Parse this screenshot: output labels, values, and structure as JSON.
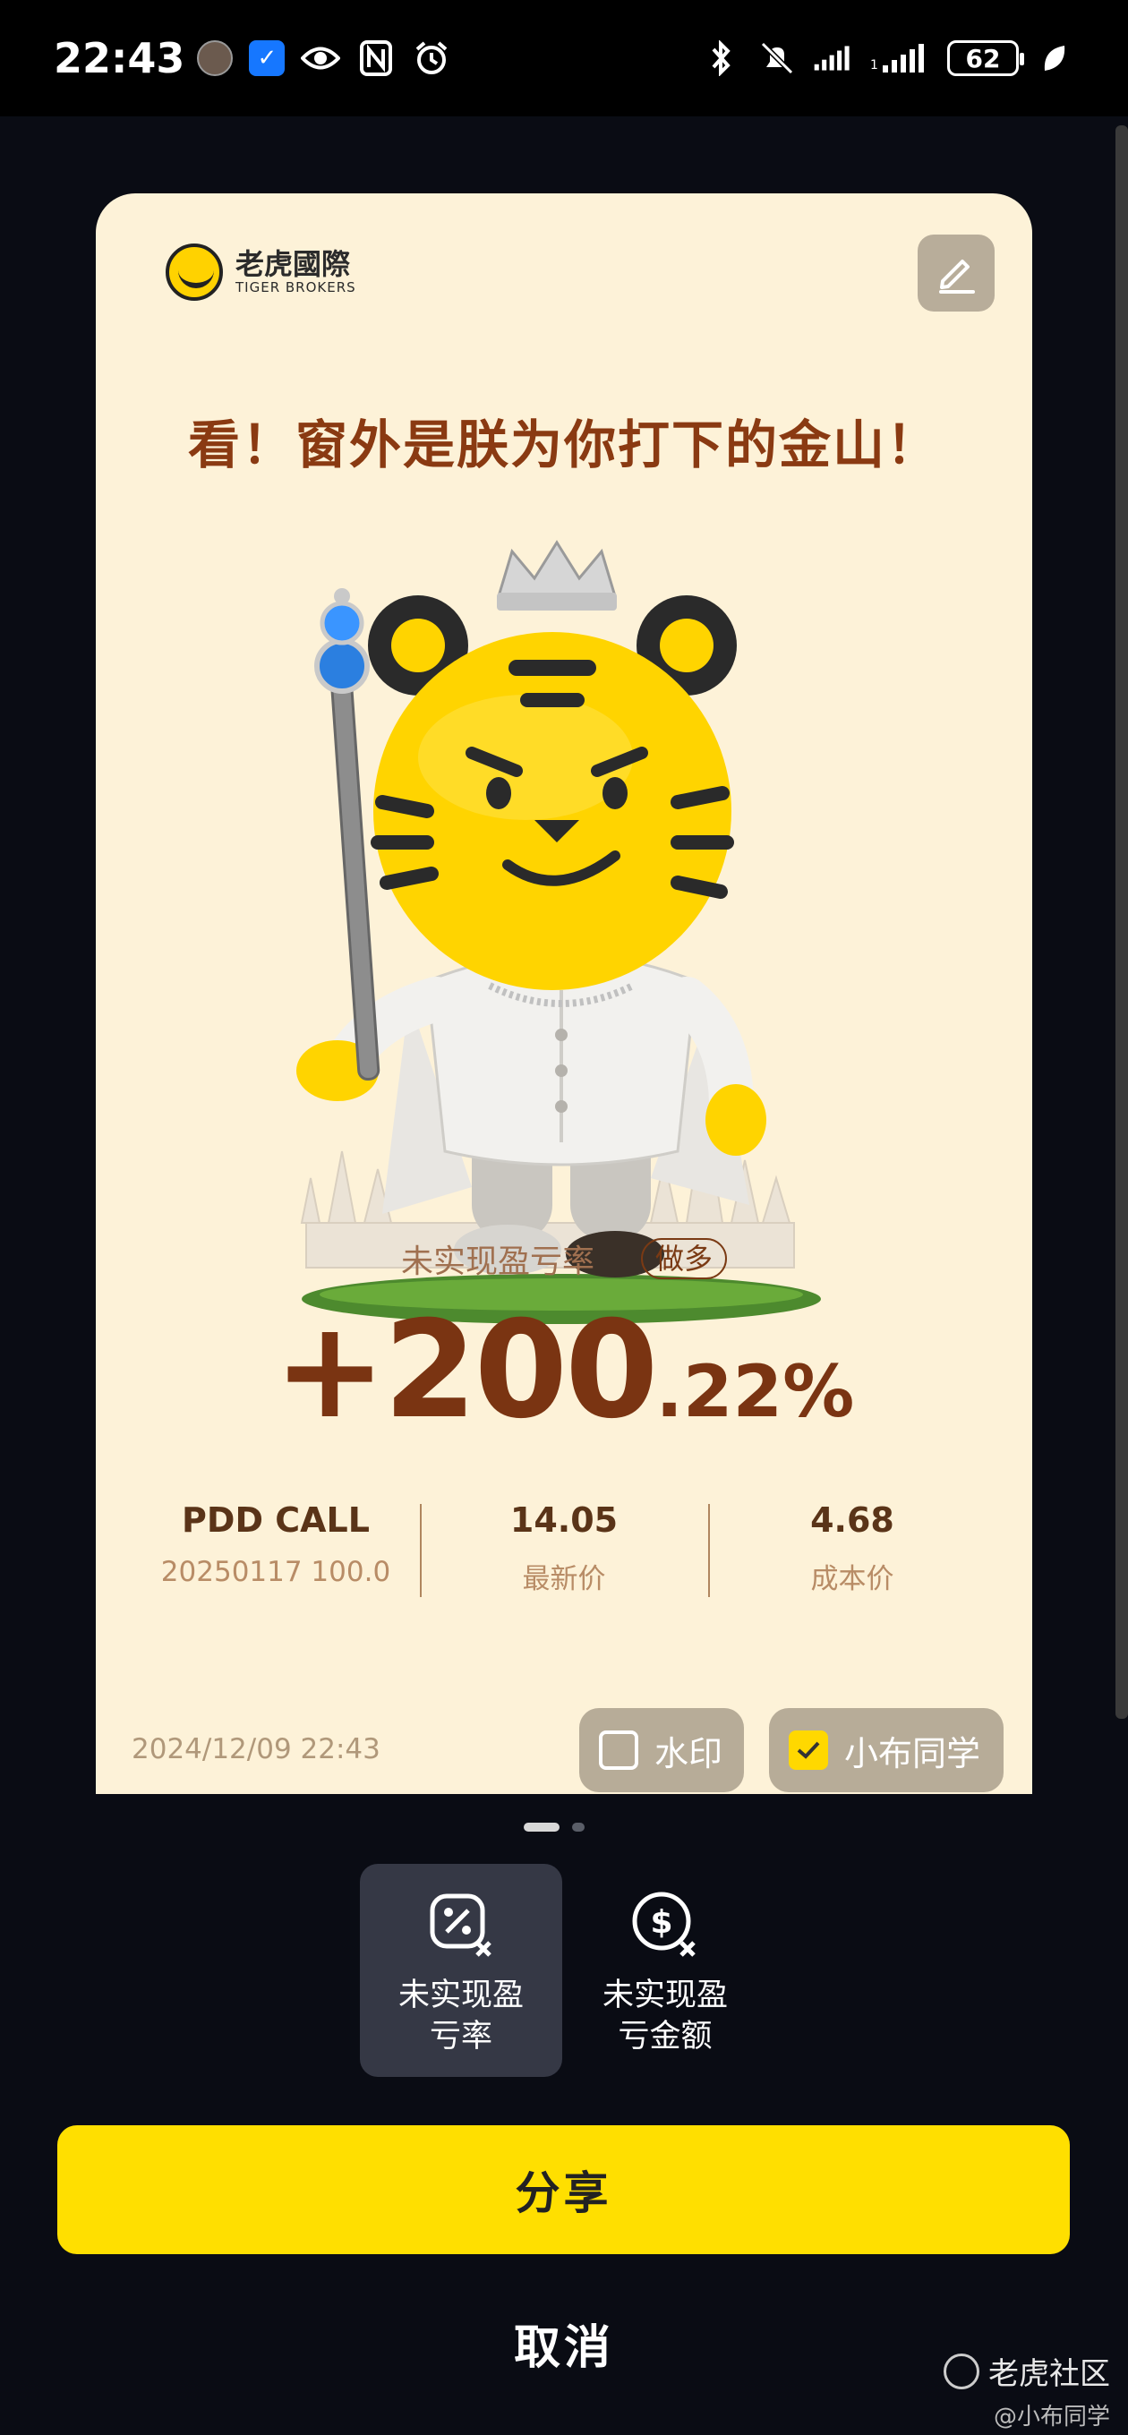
{
  "status_bar": {
    "time": "22:43",
    "battery": "62",
    "left_icons": [
      "avatar-icon",
      "app-icon",
      "eye-icon",
      "nfc-icon",
      "alarm-icon"
    ],
    "right_icons": [
      "bluetooth-icon",
      "mute-icon",
      "signal-icon",
      "signal-icon",
      "battery-icon",
      "leaf-icon"
    ]
  },
  "card": {
    "brand_name": "老虎國際",
    "brand_sub": "TIGER BROKERS",
    "headline": "看！窗外是朕为你打下的金山！",
    "metric_label": "未实现盈亏率",
    "metric_tag": "做多",
    "metric_value_main": "+200",
    "metric_value_decimal": ".22%",
    "stats": [
      {
        "main": "PDD CALL",
        "sub": "20250117 100.0"
      },
      {
        "main": "14.05",
        "sub": "最新价"
      },
      {
        "main": "4.68",
        "sub": "成本价"
      }
    ],
    "date": "2024/12/09 22:43",
    "toggles": {
      "watermark": {
        "label": "水印",
        "checked": false
      },
      "xiaobu": {
        "label": "小布同学",
        "checked": true
      }
    }
  },
  "options": [
    {
      "line1": "未实现盈",
      "line2": "亏率",
      "active": true
    },
    {
      "line1": "未实现盈",
      "line2": "亏金额",
      "active": false
    }
  ],
  "actions": {
    "share": "分享",
    "cancel": "取消"
  },
  "watermark": {
    "main": "老虎社区",
    "sub": "@小布同学"
  },
  "colors": {
    "accent": "#ffdf00",
    "card_bg": "#fdf2d8",
    "headline": "#8a3a12"
  }
}
